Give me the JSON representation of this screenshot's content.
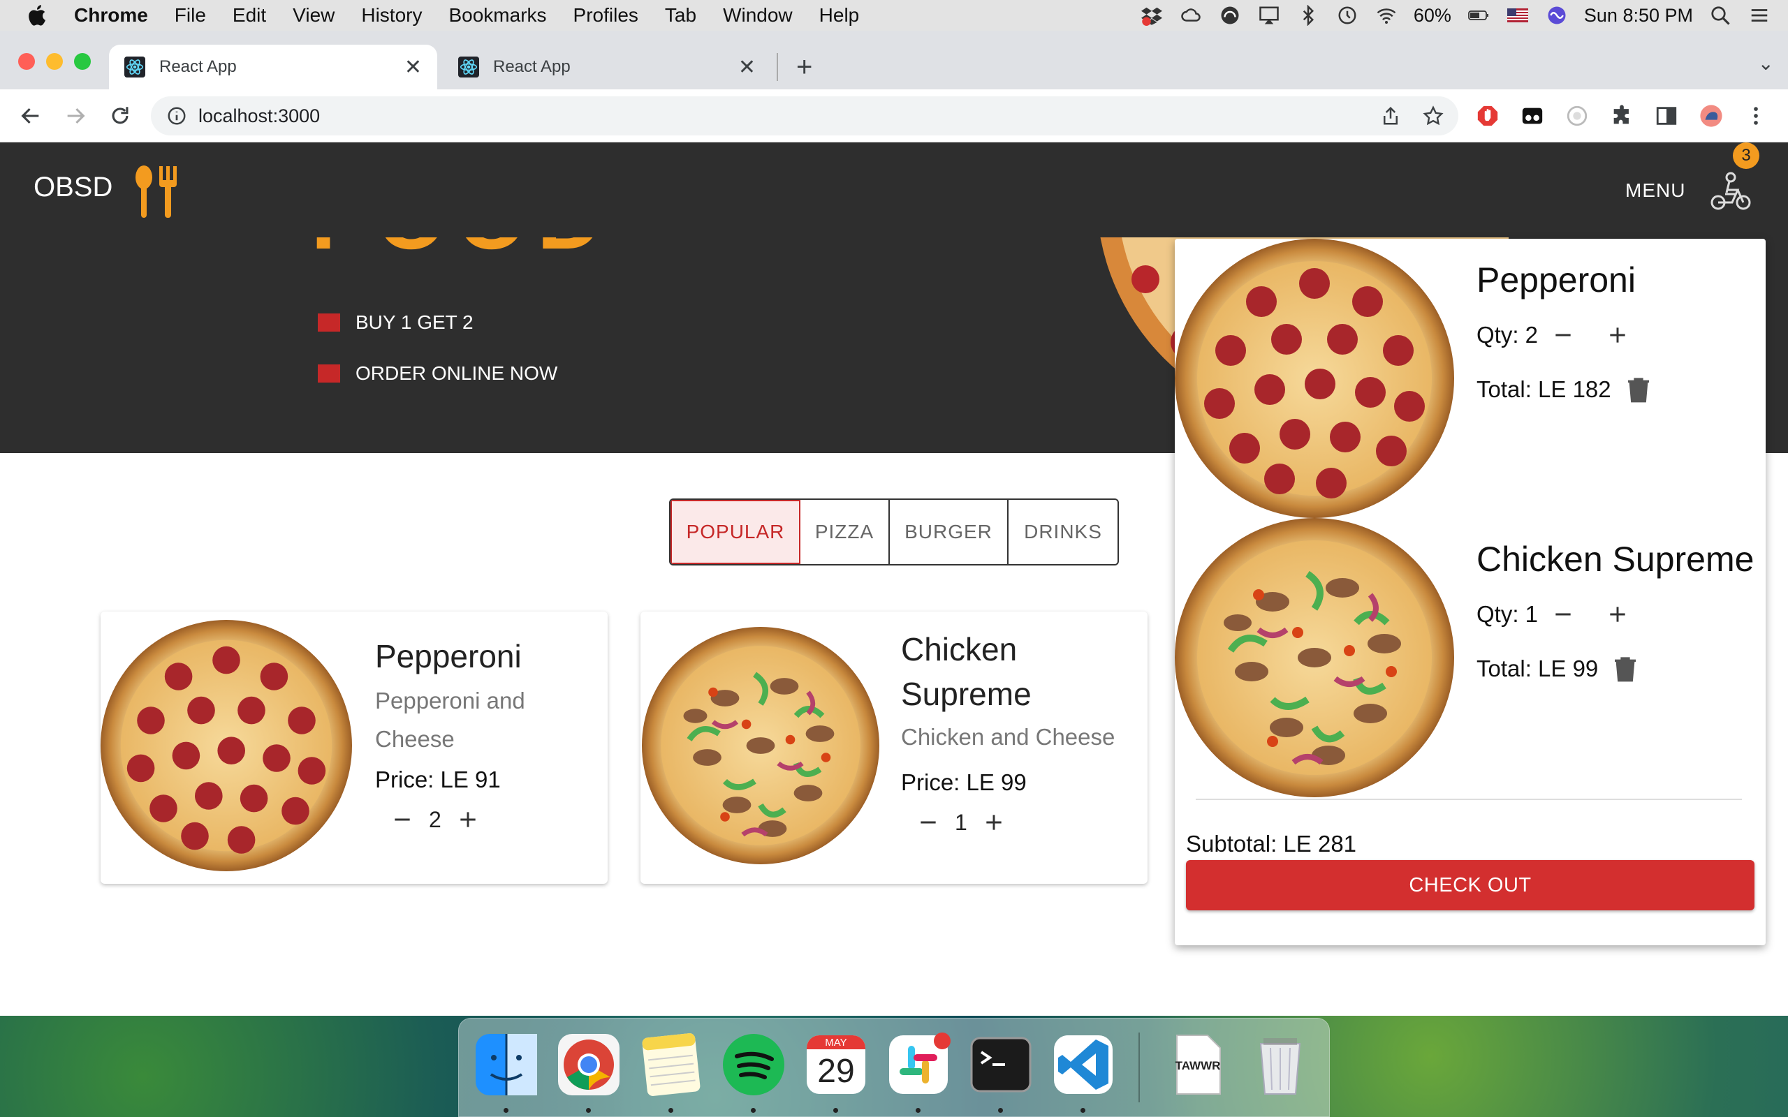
{
  "menubar": {
    "app": "Chrome",
    "items": [
      "File",
      "Edit",
      "View",
      "History",
      "Bookmarks",
      "Profiles",
      "Tab",
      "Window",
      "Help"
    ],
    "battery": "60%",
    "clock": "Sun 8:50 PM"
  },
  "browser": {
    "tabs": [
      {
        "title": "React App",
        "active": true
      },
      {
        "title": "React App",
        "active": false
      }
    ],
    "url": "localhost:3000"
  },
  "site": {
    "brand": "OBSD",
    "nav_menu": "MENU",
    "cart_count": "3",
    "hero_title": "FOOD",
    "bullets": [
      "BUY 1 GET 2",
      "ORDER ONLINE NOW"
    ],
    "accent_color": "#f39b1f",
    "brand_red": "#c62828"
  },
  "filters": {
    "items": [
      "POPULAR",
      "PIZZA",
      "BURGER",
      "DRINKS"
    ],
    "selected": "POPULAR"
  },
  "products": [
    {
      "name": "Pepperoni",
      "desc": "Pepperoni and Cheese",
      "price": "Price: LE 91",
      "qty": "2"
    },
    {
      "name": "Chicken Supreme",
      "desc": "Chicken and Cheese",
      "price": "Price: LE 99",
      "qty": "1"
    }
  ],
  "cart": {
    "items": [
      {
        "name": "Pepperoni",
        "qty_label": "Qty: 2",
        "total": "Total: LE 182"
      },
      {
        "name": "Chicken Supreme",
        "qty_label": "Qty: 1",
        "total": "Total: LE 99"
      }
    ],
    "subtotal": "Subtotal: LE 281",
    "checkout": "CHECK OUT"
  },
  "dock": {
    "calendar_month": "MAY",
    "calendar_day": "29",
    "tawwr_label": "TAWWR"
  }
}
